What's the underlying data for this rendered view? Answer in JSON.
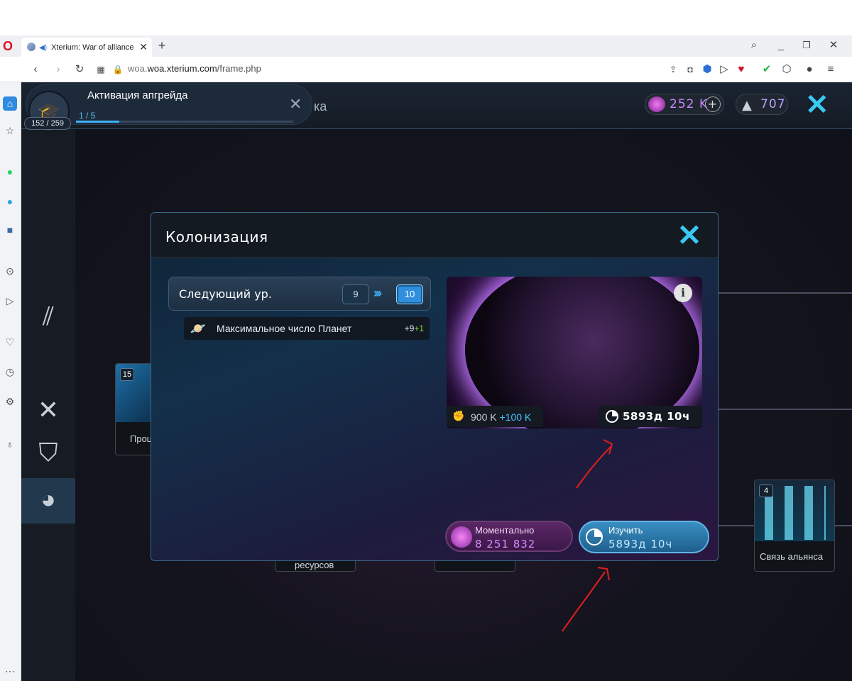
{
  "browser": {
    "tab_title": "Xterium: War of alliance",
    "url_domain": "woa.xterium.com",
    "url_path": "/frame.php"
  },
  "hud": {
    "gems": "252 K",
    "flasks": "707",
    "header_partial": "ка"
  },
  "upgrade": {
    "title": "Активация апгрейда",
    "progress_text": "1 / 5",
    "progress": 0.2,
    "count": "152 / 259"
  },
  "side_cards": {
    "left_badge": "15",
    "left_label": "Проц",
    "right_badge": "4",
    "right_label": "Связь альянса",
    "bottom_label": "ресурсов"
  },
  "dialog": {
    "title": "Колонизация",
    "next_level_label": "Следующий ур.",
    "current_level": "9",
    "next_level": "10",
    "bonus_label": "Максимальное число Планет",
    "bonus_value": "+9",
    "bonus_plus": "+1",
    "cost": "900 K",
    "cost_plus": "+100 K",
    "time": "5893д 10ч",
    "instant_label": "Моментально",
    "instant_value": "8 251 832",
    "study_label": "Изучить",
    "study_value": "5893д 10ч"
  },
  "colors": {
    "accent": "#39c9f5",
    "gem": "#c986ff",
    "annotation": "#e0201c"
  }
}
